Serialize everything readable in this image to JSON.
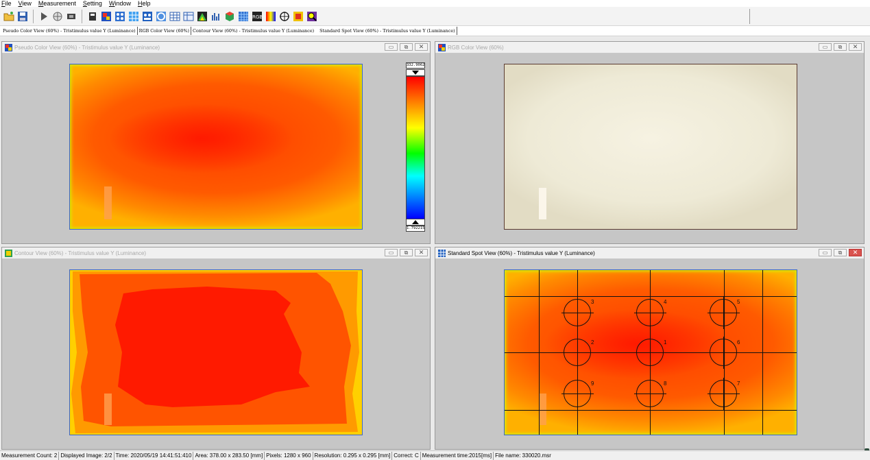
{
  "menu": [
    {
      "label": "File",
      "key": "F",
      "rest": "ile"
    },
    {
      "label": "View",
      "key": "V",
      "rest": "iew"
    },
    {
      "label": "Measurement",
      "key": "M",
      "rest": "easurement"
    },
    {
      "label": "Setting",
      "key": "S",
      "rest": "etting"
    },
    {
      "label": "Window",
      "key": "W",
      "rest": "indow"
    },
    {
      "label": "Help",
      "key": "H",
      "rest": "elp"
    }
  ],
  "toolbar": {
    "icons": [
      "open-folder-icon",
      "save-icon",
      "play-icon",
      "globe-icon",
      "film-icon",
      "stop-icon",
      "pseudo-color-icon",
      "grid-icon-1",
      "grid-icon-2",
      "grid-icon-3",
      "circle-pattern-icon",
      "table-icon-1",
      "table-icon-2",
      "palette-icon",
      "bar-chart-icon",
      "cube-icon",
      "matrix-icon",
      "rgb-icon",
      "color-gradient-icon",
      "crosshair-icon",
      "color-square-icon",
      "magnifier-icon"
    ]
  },
  "tabs": [
    "Pseudo Color View (60%) - Tristimulus value Y (Luminance)",
    "RGB Color View (60%)",
    "Contour View (60%) - Tristimulus value Y (Luminance)",
    "Standard Spot View (60%) - Tristimulus value Y (Luminance)"
  ],
  "windows": {
    "pseudo": {
      "title": "Pseudo Color View (60%) - Tristimulus value Y (Luminance)"
    },
    "rgb": {
      "title": "RGB Color View (60%)"
    },
    "contour": {
      "title": "Contour View (60%) - Tristimulus value Y (Luminance)"
    },
    "spot": {
      "title": "Standard Spot View (60%) - Tristimulus value Y (Luminance)"
    }
  },
  "scale": {
    "max": "332.9062",
    "min": "1.792215"
  },
  "spots": [
    "1",
    "2",
    "3",
    "4",
    "5",
    "6",
    "7",
    "8",
    "9"
  ],
  "window_controls": {
    "minimize": "▭",
    "restore": "⧉",
    "close": "✕"
  },
  "status": {
    "count": "Measurement Count: 2",
    "displayed": "Displayed Image: 2/2",
    "time": "Time: 2020/05/19 14:41:51:410",
    "area": "Area: 378.00 x 283.50 [mm]",
    "pixels": "Pixels: 1280 x 960",
    "resolution": "Resolution: 0.295 x 0.295 [mm]",
    "correct": "Correct: C",
    "mtime": "Measurement time:2015[ms]",
    "file": "File name: 330020.msr"
  },
  "colors": {
    "accent_red": "#ff2000",
    "accent_orange": "#ff5a00",
    "accent_yellow": "#ffd400",
    "title_active": "#000000",
    "title_inactive": "#a8a8a8"
  }
}
